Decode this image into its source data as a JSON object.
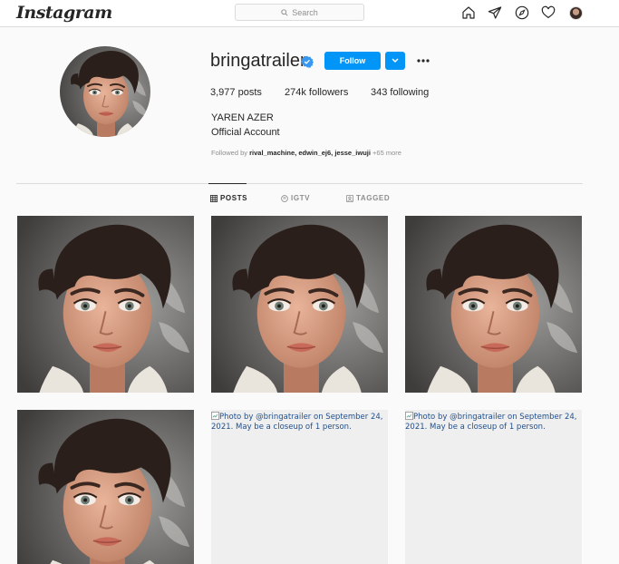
{
  "nav": {
    "logo": "Instagram",
    "search_placeholder": "Search",
    "icons": [
      "home-icon",
      "direct-icon",
      "explore-icon",
      "activity-heart-icon",
      "profile-avatar"
    ]
  },
  "profile": {
    "username": "bringatrailer",
    "verified": true,
    "follow_label": "Follow",
    "stats": {
      "posts_count": "3,977",
      "posts_label": "posts",
      "followers_count": "274k",
      "followers_label": "followers",
      "following_count": "343",
      "following_label": "following"
    },
    "full_name": "YAREN AZER",
    "category": "Official Account",
    "followed_by_prefix": "Followed by",
    "followed_by_users": "rival_machine, edwin_ej6, jesse_iwuji",
    "followed_by_more": "+65 more"
  },
  "tabs": [
    {
      "label": "POSTS",
      "icon": "grid-icon",
      "active": true
    },
    {
      "label": "IGTV",
      "icon": "igtv-icon",
      "active": false
    },
    {
      "label": "TAGGED",
      "icon": "tagged-icon",
      "active": false
    }
  ],
  "posts": [
    {
      "type": "image"
    },
    {
      "type": "image"
    },
    {
      "type": "image"
    },
    {
      "type": "image"
    },
    {
      "type": "broken",
      "alt": "Photo by @bringatrailer on September 24, 2021. May be a closeup of 1 person."
    },
    {
      "type": "broken",
      "alt": "Photo by @bringatrailer on September 24, 2021. May be a closeup of 1 person."
    }
  ],
  "colors": {
    "accent": "#0095f6",
    "background": "#fafafa",
    "border": "#dbdbdb",
    "muted_text": "#8e8e8e"
  }
}
